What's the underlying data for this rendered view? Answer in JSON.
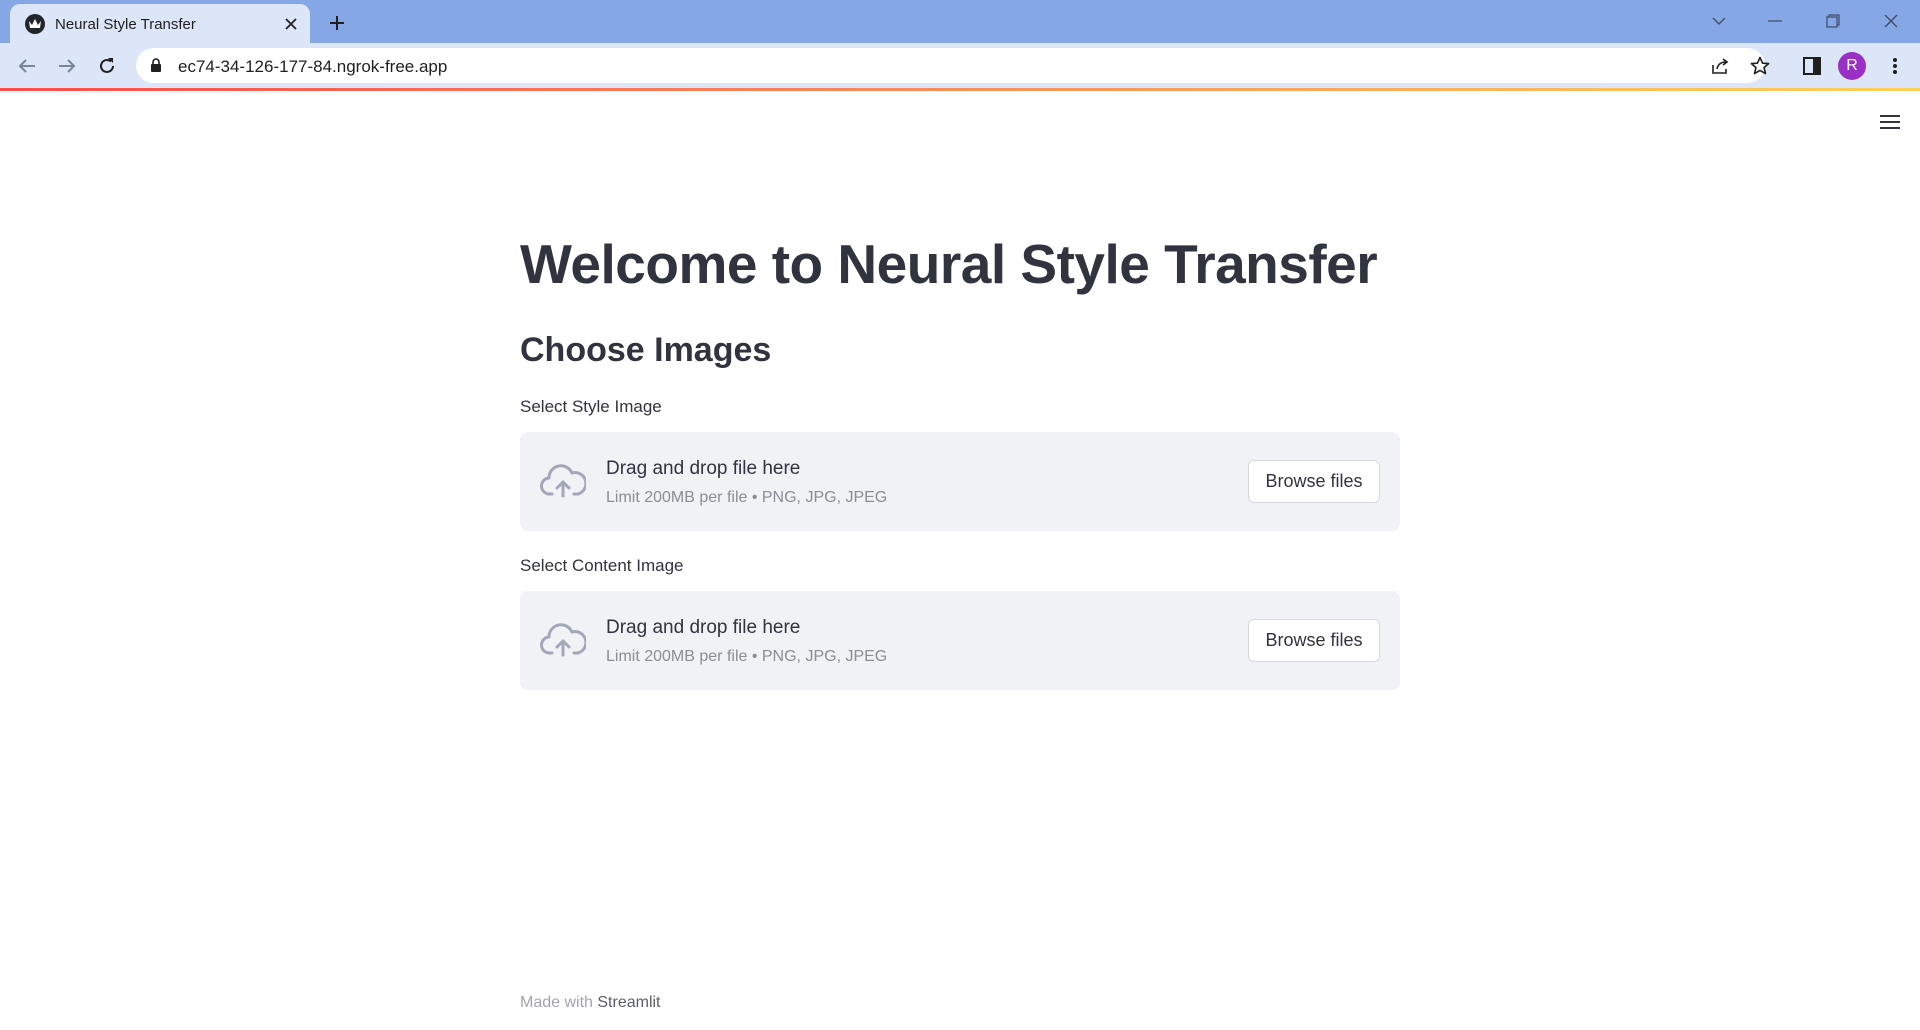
{
  "browser": {
    "tab_title": "Neural Style Transfer",
    "url": "ec74-34-126-177-84.ngrok-free.app",
    "profile_initial": "R"
  },
  "app": {
    "title": "Welcome to Neural Style Transfer",
    "subheader": "Choose Images",
    "uploaders": [
      {
        "label": "Select Style Image",
        "drag_text": "Drag and drop file here",
        "limit_text": "Limit 200MB per file • PNG, JPG, JPEG",
        "button_label": "Browse files"
      },
      {
        "label": "Select Content Image",
        "drag_text": "Drag and drop file here",
        "limit_text": "Limit 200MB per file • PNG, JPG, JPEG",
        "button_label": "Browse files"
      }
    ],
    "footer_prefix": "Made with",
    "footer_link": "Streamlit"
  },
  "icons": {
    "favicon": "streamlit-crown-icon",
    "tab_close": "close-icon",
    "new_tab": "plus-icon",
    "back": "arrow-left-icon",
    "forward": "arrow-right-icon",
    "reload": "reload-icon",
    "lock": "lock-icon",
    "share": "share-icon",
    "bookmark": "star-icon",
    "side_panel": "side-panel-icon",
    "menu": "kebab-menu-icon",
    "app_menu": "hamburger-icon",
    "upload": "cloud-upload-icon"
  },
  "colors": {
    "tabstrip": "#86a7e6",
    "toolbar": "#dce6f8",
    "text": "#31333f",
    "dropzone_bg": "#f0f2f6",
    "accent": "#ff4b4b",
    "avatar": "#9a2fc6"
  }
}
